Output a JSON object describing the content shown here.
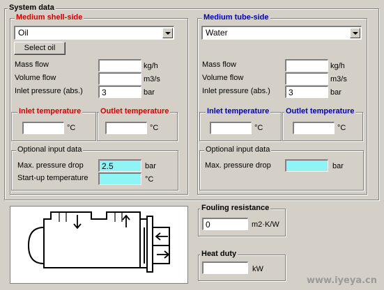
{
  "system_data": {
    "title": "System data",
    "shell": {
      "title": "Medium shell-side",
      "medium_selected": "Oil",
      "select_button": "Select oil",
      "mass_flow": {
        "label": "Mass flow",
        "value": "",
        "unit": "kg/h"
      },
      "volume_flow": {
        "label": "Volume flow",
        "value": "",
        "unit": "m3/s"
      },
      "inlet_pressure": {
        "label": "Inlet pressure (abs.)",
        "value": "3",
        "unit": "bar"
      },
      "inlet_temperature": {
        "title": "Inlet temperature",
        "value": "",
        "unit": "°C"
      },
      "outlet_temperature": {
        "title": "Outlet temperature",
        "value": "",
        "unit": "°C"
      },
      "optional": {
        "title": "Optional input data",
        "max_pressure_drop": {
          "label": "Max. pressure drop",
          "value": "2.5",
          "unit": "bar"
        },
        "startup_temperature": {
          "label": "Start-up temperature",
          "value": "",
          "unit": "°C"
        }
      }
    },
    "tube": {
      "title": "Medium tube-side",
      "medium_selected": "Water",
      "mass_flow": {
        "label": "Mass flow",
        "value": "",
        "unit": "kg/h"
      },
      "volume_flow": {
        "label": "Volume flow",
        "value": "",
        "unit": "m3/s"
      },
      "inlet_pressure": {
        "label": "Inlet pressure (abs.)",
        "value": "3",
        "unit": "bar"
      },
      "inlet_temperature": {
        "title": "Inlet temperature",
        "value": "",
        "unit": "°C"
      },
      "outlet_temperature": {
        "title": "Outlet temperature",
        "value": "",
        "unit": "°C"
      },
      "optional": {
        "title": "Optional input data",
        "max_pressure_drop": {
          "label": "Max. pressure drop",
          "value": "",
          "unit": "bar"
        }
      }
    }
  },
  "fouling": {
    "title": "Fouling resistance",
    "value": "0",
    "unit": "m2·K/W"
  },
  "heat_duty": {
    "title": "Heat duty",
    "value": "",
    "unit": "kW"
  },
  "watermark": "www.iyeya.cn",
  "colors": {
    "shell_title": "#d00000",
    "tube_title": "#0000b0",
    "optional_field": "#8ff4f4",
    "background": "#d4d0c8"
  }
}
